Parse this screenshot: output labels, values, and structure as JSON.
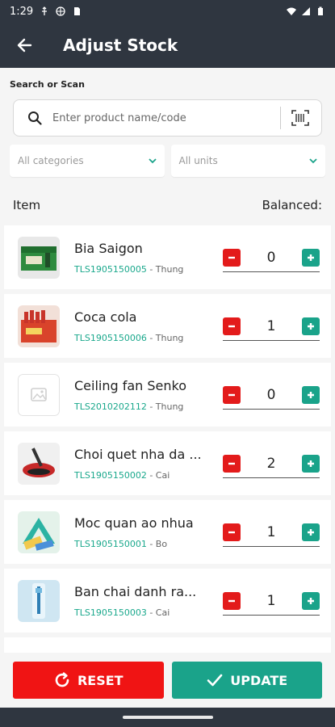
{
  "status_bar": {
    "time": "1:29"
  },
  "app_bar": {
    "title": "Adjust Stock"
  },
  "search": {
    "label": "Search or Scan",
    "placeholder": "Enter product name/code"
  },
  "filters": {
    "category": "All categories",
    "unit": "All units"
  },
  "list_header": {
    "item": "Item",
    "balanced": "Balanced:"
  },
  "items": [
    {
      "name": "Bia Saigon",
      "code": "TLS1905150005",
      "unit": "Thung",
      "qty": "0"
    },
    {
      "name": "Coca cola",
      "code": "TLS1905150006",
      "unit": "Thung",
      "qty": "1"
    },
    {
      "name": "Ceiling fan Senko",
      "code": "TLS2010202112",
      "unit": "Thung",
      "qty": "0"
    },
    {
      "name": "Choi quet nha da ...",
      "code": "TLS1905150002",
      "unit": "Cai",
      "qty": "2"
    },
    {
      "name": "Moc quan ao nhua",
      "code": "TLS1905150001",
      "unit": "Bo",
      "qty": "1"
    },
    {
      "name": "Ban chai danh ra...",
      "code": "TLS1905150003",
      "unit": "Cai",
      "qty": "1"
    }
  ],
  "meta_separator": " - ",
  "footer": {
    "reset_label": "RESET",
    "update_label": "UPDATE"
  },
  "colors": {
    "appbar": "#2f3640",
    "accent": "#1aa38a",
    "danger": "#f01414"
  }
}
